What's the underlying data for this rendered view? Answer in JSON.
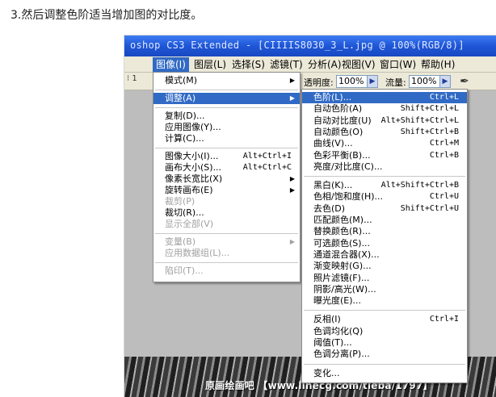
{
  "caption": "3.然后调整色阶适当增加图的对比度。",
  "window": {
    "title": "oshop CS3 Extended - [CIIIIS8030_3_L.jpg @ 100%(RGB/8)]"
  },
  "menubar": {
    "items": [
      {
        "label": "图像(I)",
        "active": true
      },
      {
        "label": "图层(L)"
      },
      {
        "label": "选择(S)"
      },
      {
        "label": "滤镜(T)"
      },
      {
        "label": "分析(A)"
      },
      {
        "label": "视图(V)"
      },
      {
        "label": "窗口(W)"
      },
      {
        "label": "帮助(H)"
      }
    ]
  },
  "options": {
    "ruler_text": "⁝ 1",
    "opacity_label": "透明度:",
    "opacity_value": "100%",
    "flow_label": "流量:",
    "flow_value": "100%"
  },
  "image_menu": [
    {
      "label": "模式(M)",
      "submenu": true
    },
    {
      "sep": true
    },
    {
      "label": "调整(A)",
      "submenu": true,
      "highlight": true
    },
    {
      "sep": true
    },
    {
      "label": "复制(D)..."
    },
    {
      "label": "应用图像(Y)..."
    },
    {
      "label": "计算(C)..."
    },
    {
      "sep": true
    },
    {
      "label": "图像大小(I)...",
      "shortcut": "Alt+Ctrl+I"
    },
    {
      "label": "画布大小(S)...",
      "shortcut": "Alt+Ctrl+C"
    },
    {
      "label": "像素长宽比(X)",
      "submenu": true
    },
    {
      "label": "旋转画布(E)",
      "submenu": true
    },
    {
      "label": "裁剪(P)",
      "disabled": true
    },
    {
      "label": "裁切(R)..."
    },
    {
      "label": "显示全部(V)",
      "disabled": true
    },
    {
      "sep": true
    },
    {
      "label": "变量(B)",
      "submenu": true,
      "disabled": true
    },
    {
      "label": "应用数据组(L)...",
      "disabled": true
    },
    {
      "sep": true
    },
    {
      "label": "陷印(T)...",
      "disabled": true
    }
  ],
  "adjust_menu": [
    {
      "label": "色阶(L)...",
      "shortcut": "Ctrl+L",
      "highlight": true
    },
    {
      "label": "自动色阶(A)",
      "shortcut": "Shift+Ctrl+L"
    },
    {
      "label": "自动对比度(U)",
      "shortcut": "Alt+Shift+Ctrl+L"
    },
    {
      "label": "自动颜色(O)",
      "shortcut": "Shift+Ctrl+B"
    },
    {
      "label": "曲线(V)...",
      "shortcut": "Ctrl+M"
    },
    {
      "label": "色彩平衡(B)...",
      "shortcut": "Ctrl+B"
    },
    {
      "label": "亮度/对比度(C)..."
    },
    {
      "sep": true
    },
    {
      "label": "黑白(K)...",
      "shortcut": "Alt+Shift+Ctrl+B"
    },
    {
      "label": "色相/饱和度(H)...",
      "shortcut": "Ctrl+U"
    },
    {
      "label": "去色(D)",
      "shortcut": "Shift+Ctrl+U"
    },
    {
      "label": "匹配颜色(M)..."
    },
    {
      "label": "替换颜色(R)..."
    },
    {
      "label": "可选颜色(S)..."
    },
    {
      "label": "通道混合器(X)..."
    },
    {
      "label": "渐变映射(G)..."
    },
    {
      "label": "照片滤镜(F)..."
    },
    {
      "label": "阴影/高光(W)..."
    },
    {
      "label": "曝光度(E)..."
    },
    {
      "sep": true
    },
    {
      "label": "反相(I)",
      "shortcut": "Ctrl+I"
    },
    {
      "label": "色调均化(Q)"
    },
    {
      "label": "阈值(T)..."
    },
    {
      "label": "色调分离(P)..."
    },
    {
      "sep": true
    },
    {
      "label": "变化..."
    }
  ],
  "watermark": "原画绘画吧 【www.linecg.com/tieba/1797】",
  "colors": {
    "highlight": "#316ac5",
    "titlebar": "#1f56d6",
    "menubar": "#ece9d8"
  }
}
